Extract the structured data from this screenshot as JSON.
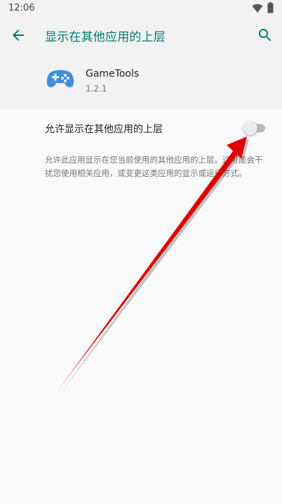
{
  "status_bar": {
    "time": "12:06",
    "icons": [
      "wifi-icon",
      "battery-icon"
    ]
  },
  "app_bar": {
    "title": "显示在其他应用的上层",
    "back_icon": "arrow-back-icon",
    "search_icon": "search-icon"
  },
  "app": {
    "name": "GameTools",
    "version": "1.2.1",
    "icon": "gamepad-icon"
  },
  "setting": {
    "label": "允许显示在其他应用的上层",
    "toggle_on": false
  },
  "description": "允许此应用显示在您当前使用的其他应用的上层。这可能会干扰您使用相关应用，或变更这类应用的显示或运行方式。",
  "colors": {
    "accent": "#00796b",
    "annotation_arrow": "#e00000"
  }
}
